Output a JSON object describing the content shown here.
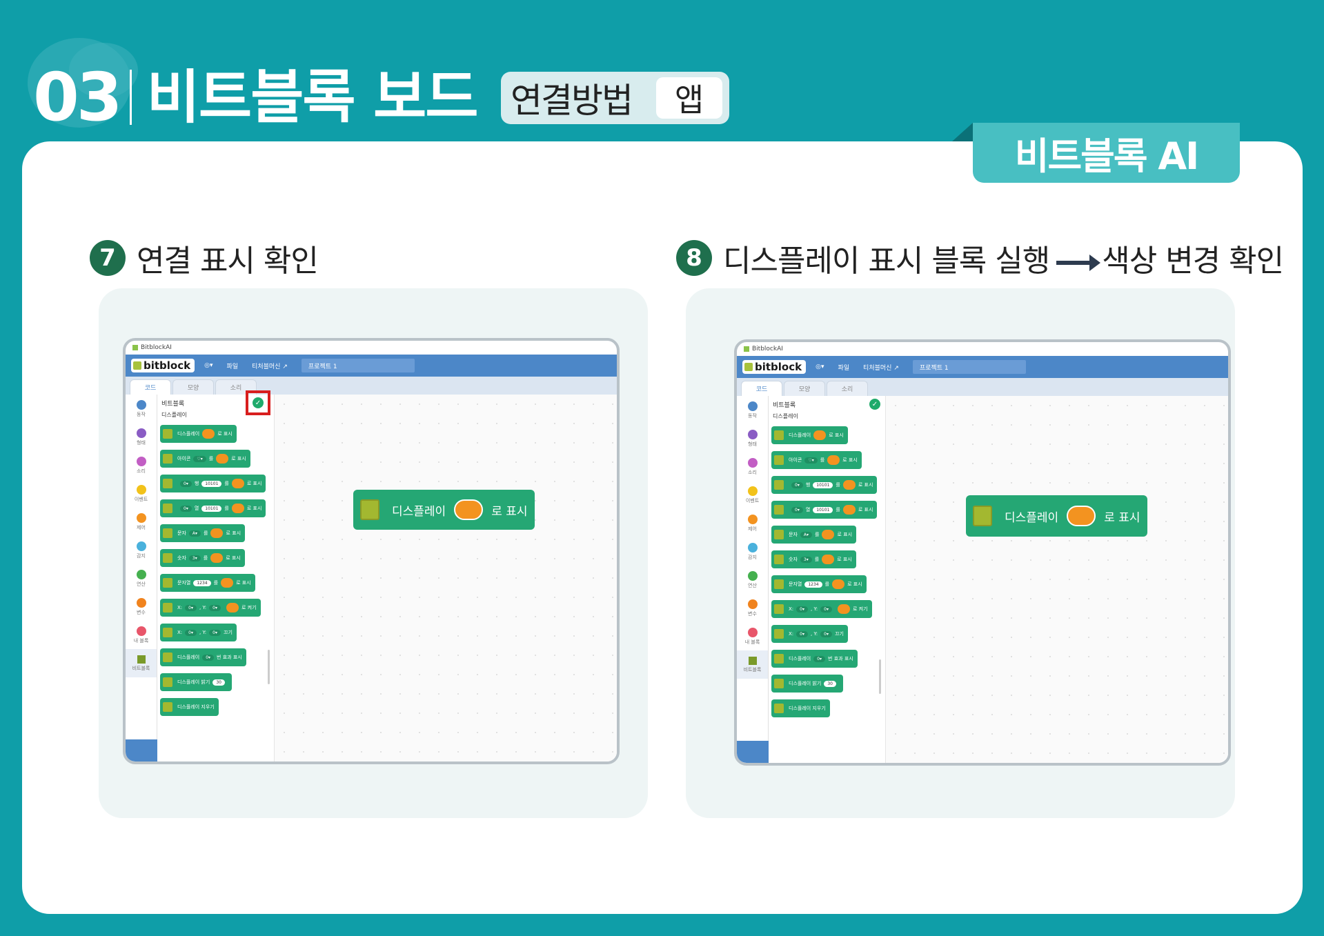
{
  "header": {
    "section_number": "03",
    "title": "비트블록 보드",
    "subtitle": "연결방법",
    "subtitle_tag": "앱",
    "category_tab": "비트블록 AI"
  },
  "steps": [
    {
      "number": "7",
      "text": "연결 표시 확인"
    },
    {
      "number": "8",
      "text_before_arrow": "디스플레이 표시 블록 실행",
      "text_after_arrow": "색상 변경 확인"
    }
  ],
  "app": {
    "window_title": "BitblockAI",
    "logo": "bitblock",
    "menu": {
      "globe": "◎▾",
      "file": "파일",
      "teachable": "티처블머신",
      "external": "↗"
    },
    "project_name": "프로젝트 1",
    "tabs": [
      {
        "label": "코드",
        "icon": "code-icon"
      },
      {
        "label": "모양",
        "icon": "brush-icon"
      },
      {
        "label": "소리",
        "icon": "speaker-icon"
      }
    ],
    "categories": [
      {
        "label": "동작",
        "color": "#4c87c8"
      },
      {
        "label": "형태",
        "color": "#8a5cc4"
      },
      {
        "label": "소리",
        "color": "#c25ec4"
      },
      {
        "label": "이벤트",
        "color": "#f2c21a"
      },
      {
        "label": "제어",
        "color": "#f39320"
      },
      {
        "label": "감지",
        "color": "#4ab1dc"
      },
      {
        "label": "연산",
        "color": "#45b04f"
      },
      {
        "label": "변수",
        "color": "#f0831e"
      },
      {
        "label": "내 블록",
        "color": "#e8566a"
      },
      {
        "label": "비트블록",
        "color": "#7a9a2a"
      }
    ],
    "palette_title": "비트블록",
    "palette_subtitle": "디스플레이",
    "blocks": {
      "b1": {
        "a": "디스플레이",
        "b": "로 표시"
      },
      "b2": {
        "a": "아이콘",
        "icon": "♡▾",
        "b": "를",
        "c": "로 표시"
      },
      "b3": {
        "dd": "0▾",
        "a": "행",
        "pill": "10101",
        "b": "를",
        "c": "로 표시"
      },
      "b4": {
        "dd": "0▾",
        "a": "열",
        "pill": "10101",
        "b": "를",
        "c": "로 표시"
      },
      "b5": {
        "a": "문자",
        "dd": "A▾",
        "b": "를",
        "c": "로 표시"
      },
      "b6": {
        "a": "숫자",
        "dd": "3▾",
        "b": "를",
        "c": "로 표시"
      },
      "b7": {
        "a": "문자열",
        "pill": "1234",
        "b": "를",
        "c": "로 표시"
      },
      "b8": {
        "x": "X:",
        "dd1": "0▾",
        "y": ", Y:",
        "dd2": "0▾",
        "c": "로 켜기"
      },
      "b9": {
        "x": "X:",
        "dd1": "0▾",
        "y": ", Y:",
        "dd2": "0▾",
        "c": "끄기"
      },
      "b10": {
        "a": "디스플레이",
        "dd": "0▾",
        "c": "번 효과 표시"
      },
      "b11": {
        "a": "디스플레이 밝기",
        "pill": "30"
      },
      "b12": {
        "a": "디스플레이 지우기"
      }
    },
    "canvas_block": {
      "a": "디스플레이",
      "b": "로 표시"
    },
    "accent_colors": {
      "block": "#25a774",
      "led": "#f39320",
      "menubar": "#4c87c8",
      "highlight": "#d81e1e"
    }
  }
}
